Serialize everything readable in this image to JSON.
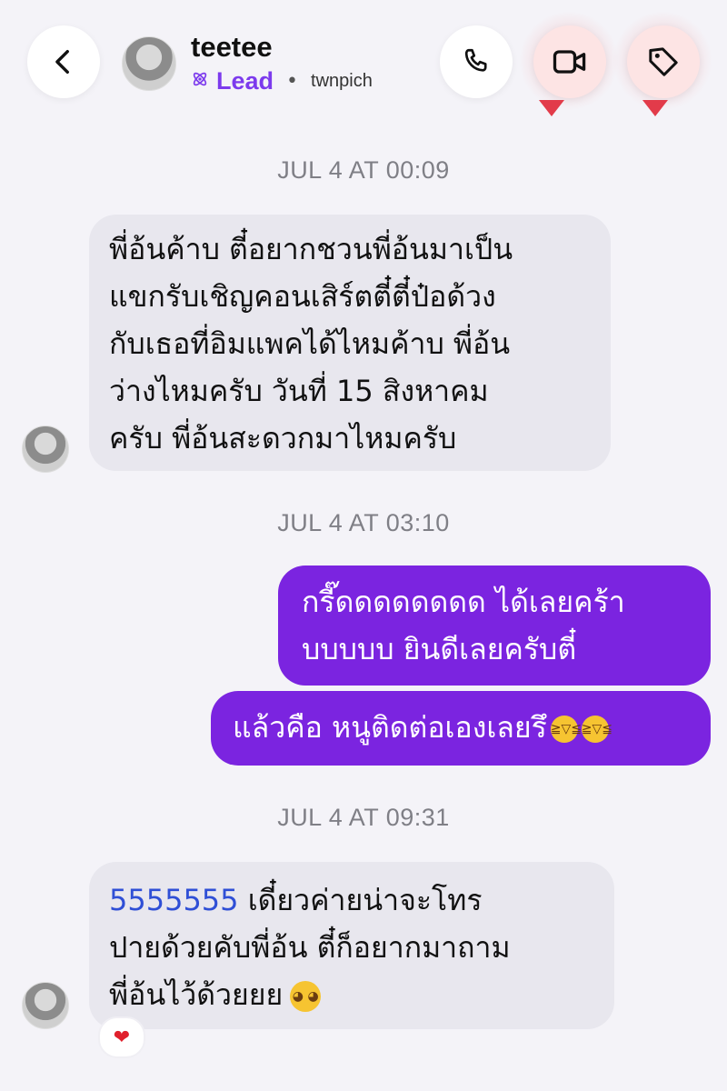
{
  "header": {
    "username": "teetee",
    "badge": "Lead",
    "separator": "•",
    "handle": "twnpich",
    "accent": "#7c3aed"
  },
  "icons": {
    "back": "chevron-left-icon",
    "call": "phone-icon",
    "video": "video-camera-icon",
    "tag": "tag-icon",
    "lead": "atom-icon",
    "reaction": "heart-icon"
  },
  "messages": [
    {
      "timestamp": "JUL 4 AT 00:09",
      "direction": "incoming",
      "lines": [
        "พี่อ้นค้าบ ตี๋อยากชวนพี่อ้นมาเป็น",
        "แขกรับเชิญคอนเสิร์ตตี๋ตี๋ป๋อด้วง",
        "กับเธอที่อิมแพคได้ไหมค้าบ พี่อ้น",
        "ว่างไหมครับ วันที่ 15 สิงหาคม",
        "ครับ พี่อ้นสะดวกมาไหมครับ"
      ]
    },
    {
      "timestamp": "JUL 4 AT 03:10",
      "direction": "outgoing",
      "lines": [
        "กรี๊ดดดดดดดด ได้เลยคร้า",
        "บบบบบ ยินดีเลยครับตี๋"
      ]
    },
    {
      "direction": "outgoing",
      "lines": [
        "แล้วคือ หนูติดต่อเองเลยรึ"
      ],
      "emoji": [
        "rolling-on-floor-laughing",
        "rolling-on-floor-laughing"
      ]
    },
    {
      "timestamp": "JUL 4 AT 09:31",
      "direction": "incoming",
      "link_number": "5555555",
      "lines": [
        " เดี๋ยวค่ายน่าจะโทร",
        "ปายด้วยคับพี่อ้น ตี๋ก็อยากมาถาม",
        "พี่อ้นไว้ด้วยยย"
      ],
      "emoji": [
        "pleading-face"
      ],
      "reaction": "❤"
    }
  ],
  "colors": {
    "outgoing_bubble": "#7b24e0",
    "incoming_bubble": "#e8e7ee",
    "link": "#2f4fd6",
    "timestamp": "#7f7f86"
  }
}
